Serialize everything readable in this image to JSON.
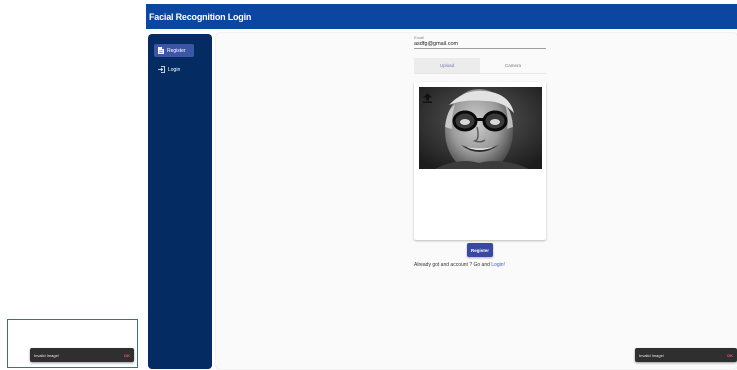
{
  "app": {
    "title": "Facial Recognition Login"
  },
  "sidebar": {
    "items": [
      {
        "label": "Register",
        "icon": "file-icon",
        "active": true
      },
      {
        "label": "Login",
        "icon": "login-icon",
        "active": false
      }
    ]
  },
  "form": {
    "email_label": "Email",
    "email_value": "asdfg@gmail.com",
    "tabs": [
      {
        "label": "Upload",
        "active": true
      },
      {
        "label": "Camera",
        "active": false
      }
    ],
    "register_label": "Register",
    "account_text": "Already got and account ? Go and",
    "login_link": "Login!"
  },
  "toasts": {
    "left": {
      "message": "Invalid Image!",
      "action": "OK"
    },
    "right": {
      "message": "Invalid Image!",
      "action": "OK"
    }
  },
  "colors": {
    "app_bar": "#0b47a0",
    "sidebar": "#042c63",
    "nav_active": "#3d55a6",
    "button": "#3848a3",
    "toast_action": "#ff4f6a"
  }
}
